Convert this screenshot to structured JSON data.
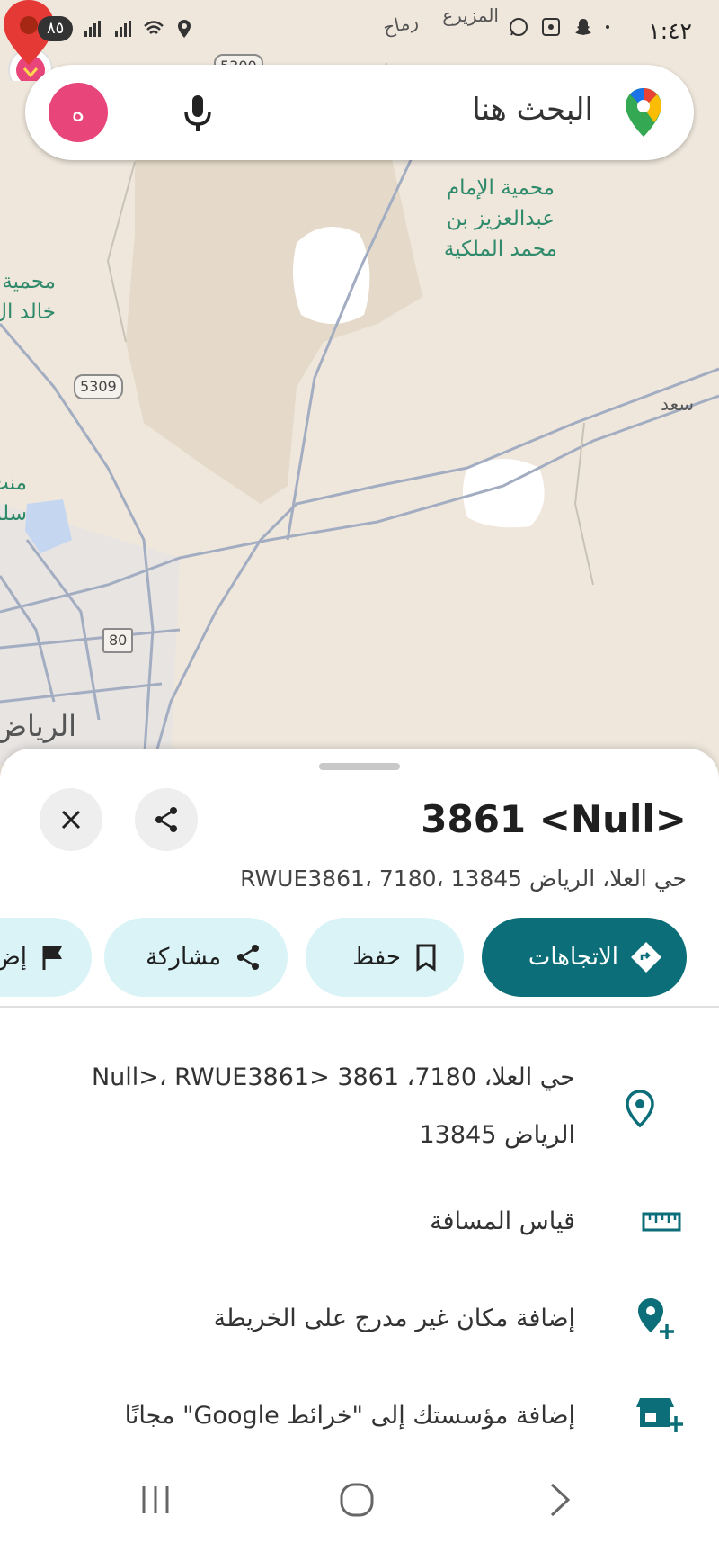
{
  "status_bar": {
    "time": "١:٤٢",
    "battery": "٨٥"
  },
  "search": {
    "placeholder": "البحث هنا",
    "avatar_letter": "ه"
  },
  "map": {
    "labels": {
      "reserve_1_line1": "محمية الإمام",
      "reserve_1_line2": "عبدالعزيز بن",
      "reserve_1_line3": "محمد الملكية",
      "reserve_2_line1": "محمية",
      "reserve_2_line2": "خالد ال",
      "area_1_line1": "منت",
      "area_1_line2": "سلم",
      "top_label_1": "المزيرع",
      "top_label_2": "رماح",
      "right_label": "سعد",
      "city": "الرياض"
    },
    "shields": {
      "road_5309": "5309",
      "road_5300": "5300",
      "road_80": "80"
    }
  },
  "place": {
    "title": "3861 <Null>",
    "address": "حي العلا، الرياض 13845 ،RWUE3861، 7180",
    "actions": {
      "directions": "الاتجاهات",
      "save": "حفظ",
      "share": "مشاركة",
      "label": "إض"
    },
    "details": {
      "address_line1": "حي العلا، 7180، 3861 <Null>، RWUE3861",
      "address_line2": "الرياض 13845",
      "measure": "قياس المسافة",
      "add_place": "إضافة مكان غير مدرج على الخريطة",
      "add_business": "إضافة مؤسستك إلى \"خرائط Google\" مجانًا"
    }
  },
  "colors": {
    "primary": "#0b6e78",
    "tonal": "#d9f3f7",
    "icon_teal": "#0b6e78",
    "pin_red": "#e53935",
    "avatar": "#e8467b",
    "reserve_text": "#2f8a6b"
  }
}
